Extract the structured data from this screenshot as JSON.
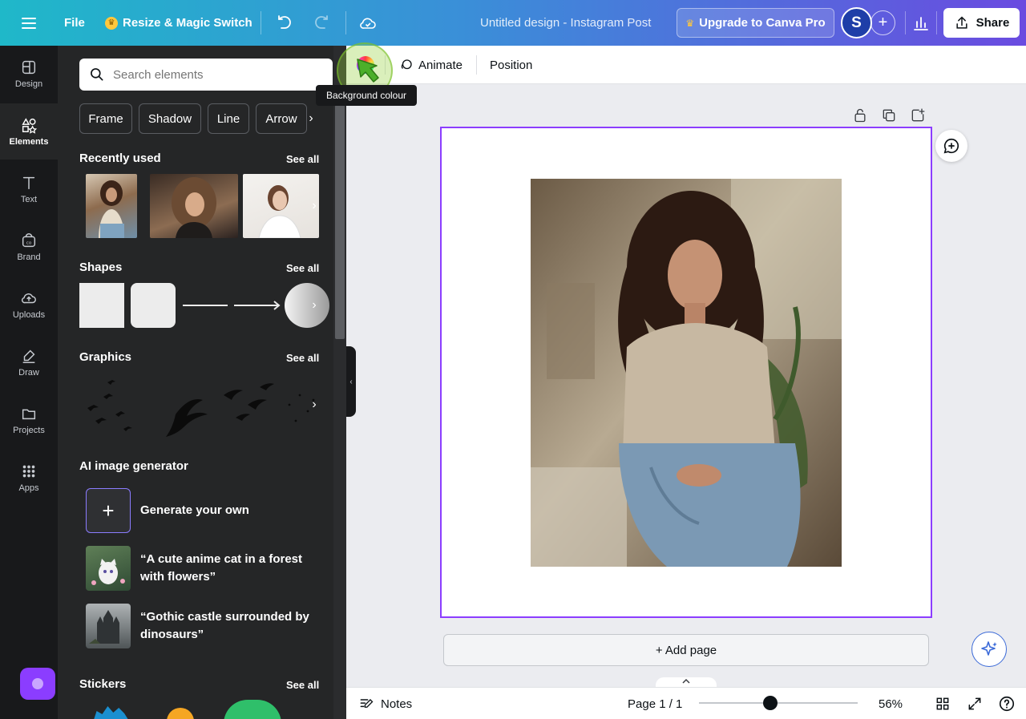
{
  "topbar": {
    "file_label": "File",
    "resize_label": "Resize & Magic Switch",
    "doc_title": "Untitled design - Instagram Post",
    "upgrade_label": "Upgrade to Canva Pro",
    "avatar_initial": "S",
    "share_label": "Share"
  },
  "rail": {
    "items": [
      {
        "label": "Design",
        "icon": "design-icon"
      },
      {
        "label": "Elements",
        "icon": "elements-icon"
      },
      {
        "label": "Text",
        "icon": "text-icon"
      },
      {
        "label": "Brand",
        "icon": "brand-icon"
      },
      {
        "label": "Uploads",
        "icon": "uploads-icon"
      },
      {
        "label": "Draw",
        "icon": "draw-icon"
      },
      {
        "label": "Projects",
        "icon": "projects-icon"
      },
      {
        "label": "Apps",
        "icon": "apps-icon"
      }
    ],
    "active": "Elements"
  },
  "panel": {
    "search_placeholder": "Search elements",
    "chips": [
      "Frame",
      "Shadow",
      "Line",
      "Arrow"
    ],
    "sections": {
      "recent": {
        "title": "Recently used",
        "see_all": "See all"
      },
      "shapes": {
        "title": "Shapes",
        "see_all": "See all"
      },
      "graphics": {
        "title": "Graphics",
        "see_all": "See all"
      },
      "ai": {
        "title": "AI image generator"
      },
      "stickers": {
        "title": "Stickers",
        "see_all": "See all"
      }
    },
    "ai_items": [
      {
        "label": "Generate your own"
      },
      {
        "label": "“A cute anime cat in a forest with flowers”"
      },
      {
        "label": "“Gothic castle surrounded by dinosaurs”"
      }
    ]
  },
  "toolbar": {
    "animate_label": "Animate",
    "position_label": "Position",
    "tooltip": "Background colour"
  },
  "canvas": {
    "add_page_label": "+ Add page"
  },
  "bottombar": {
    "notes_label": "Notes",
    "page_indicator": "Page 1 / 1",
    "zoom_percent": "56%",
    "zoom_level": 0.45
  },
  "colors": {
    "accent": "#8b3dff",
    "topbar_start": "#1fb8c9",
    "topbar_end": "#6a4be0",
    "panel_bg": "#252627",
    "rail_bg": "#18191b"
  }
}
